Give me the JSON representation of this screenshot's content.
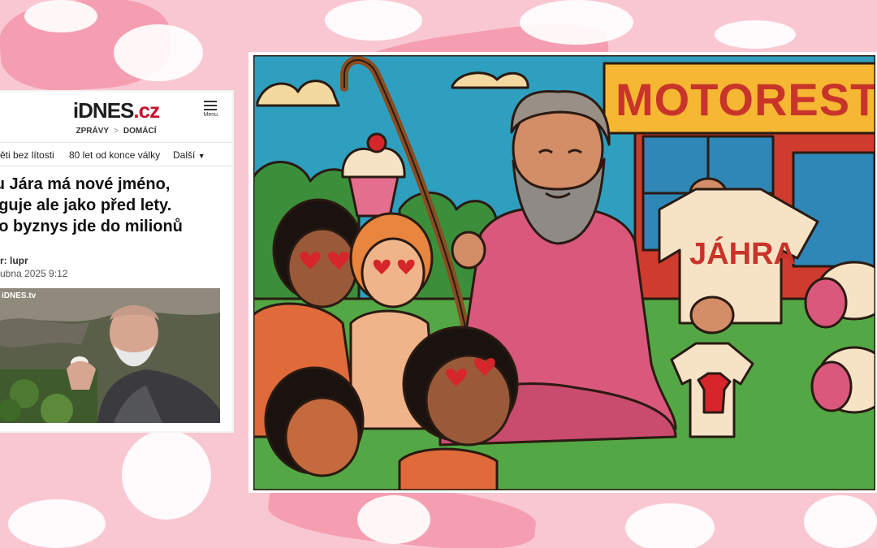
{
  "site": {
    "logo_part1": "iDNES",
    "logo_part2": ".cz",
    "menu_label": "Menu",
    "breadcrumb_1": "ZPRÁVY",
    "breadcrumb_sep": ">",
    "breadcrumb_2": "DOMÁCÍ"
  },
  "tags": {
    "tag_1": "ěti bez lítosti",
    "tag_2": "80 let od konce války",
    "more": "Další"
  },
  "article": {
    "headline_lines": [
      "ru Jára má nové jméno,",
      "nguje ale jako před lety.",
      "ho byznys jde do milionů"
    ],
    "author": "r: lupr",
    "date": "ubna 2025  9:12",
    "video_watermark": "iDNES.tv"
  },
  "cartoon": {
    "sign_text": "MOTOREST",
    "shirt_text": "JÁHRA"
  },
  "colors": {
    "brand_red": "#c8102e",
    "background_pink": "#f9c7d2",
    "sign_yellow": "#f6b733",
    "robe_pink": "#d9587c"
  }
}
